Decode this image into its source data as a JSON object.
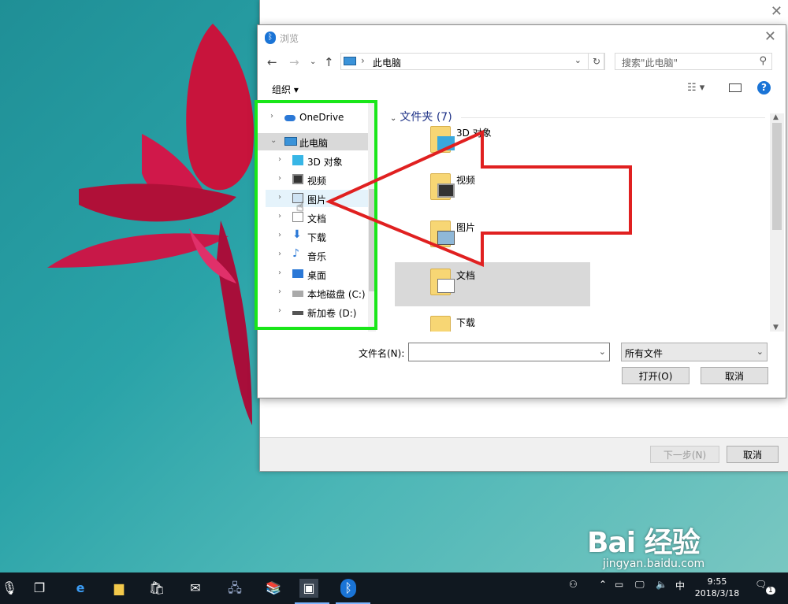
{
  "dialog": {
    "title": "浏览",
    "address_path": "此电脑",
    "search_placeholder": "搜索\"此电脑\"",
    "organize_label": "组织 ▾",
    "group_header": "文件夹 (7)",
    "filename_label": "文件名(N):",
    "filename_value": "",
    "filetype_value": "所有文件",
    "open_button": "打开(O)",
    "cancel_button": "取消"
  },
  "nav_tree": {
    "onedrive": "OneDrive",
    "this_pc": "此电脑",
    "items": [
      "3D 对象",
      "视频",
      "图片",
      "文档",
      "下载",
      "音乐",
      "桌面",
      "本地磁盘 (C:)",
      "新加卷 (D:)"
    ]
  },
  "folders": [
    "3D 对象",
    "视频",
    "图片",
    "文档",
    "下载"
  ],
  "wizard": {
    "next_button": "下一步(N)",
    "cancel_button": "取消"
  },
  "taskbar": {
    "ime_label": "中",
    "time": "9:55",
    "date": "2018/3/18",
    "notification_count": "1"
  },
  "watermark": {
    "brand": "Bai 经验",
    "url": "jingyan.baidu.com"
  },
  "colors": {
    "highlight_box": "#19e619",
    "arrow": "#e02020",
    "group_header": "#1e3287"
  }
}
